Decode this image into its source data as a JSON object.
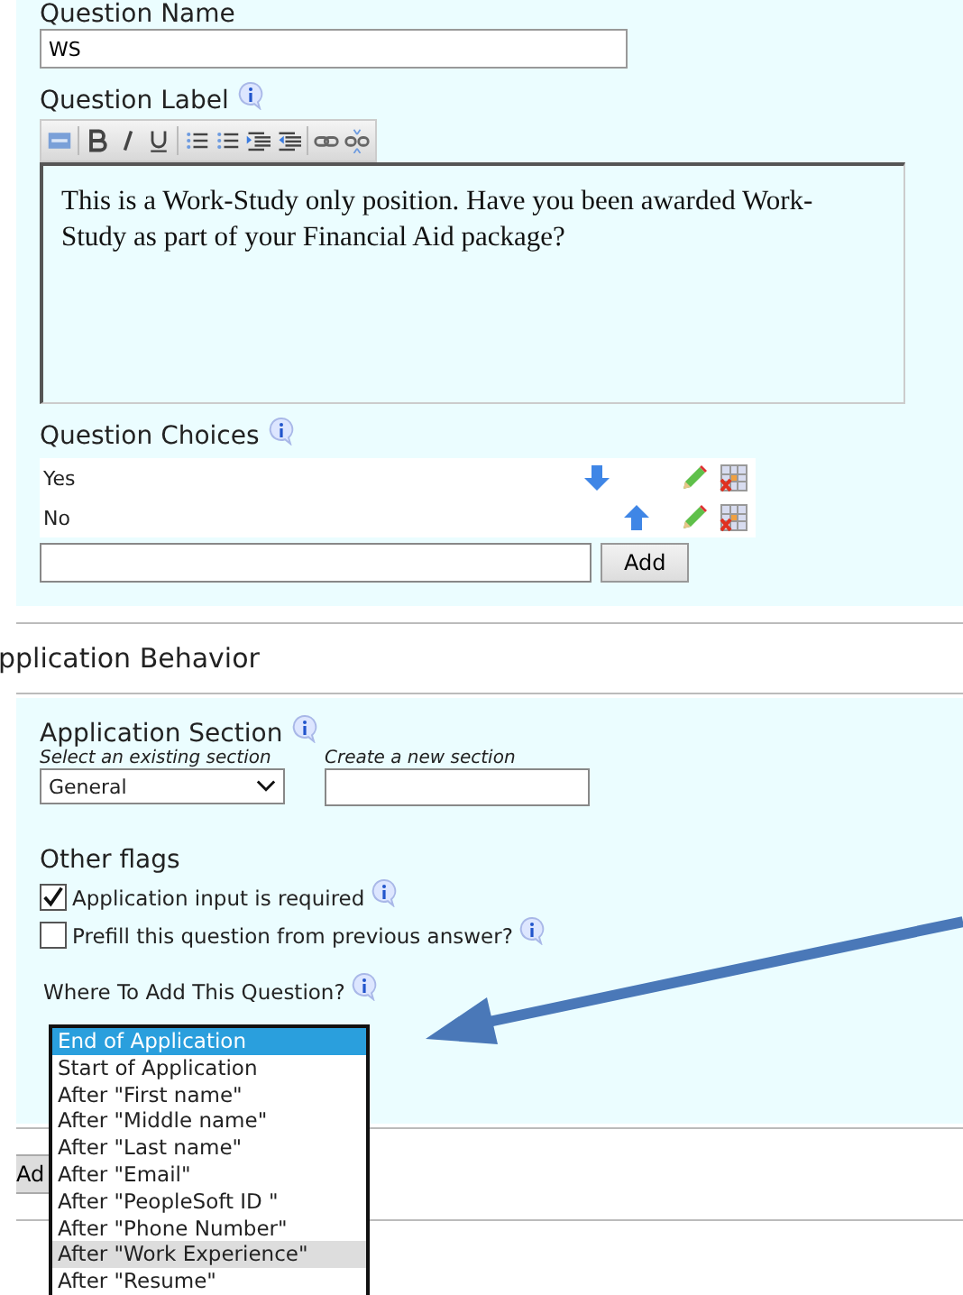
{
  "question_name": {
    "label": "Question Name",
    "value": "WS"
  },
  "question_label": {
    "label": "Question Label",
    "toolbar": [
      {
        "kind": "html"
      },
      {
        "kind": "bold"
      },
      {
        "kind": "italic"
      },
      {
        "kind": "underline"
      },
      {
        "kind": "numbered"
      },
      {
        "kind": "bulleted"
      },
      {
        "kind": "indent"
      },
      {
        "kind": "outdent"
      },
      {
        "kind": "link"
      },
      {
        "kind": "unlink"
      }
    ],
    "text": "This is a Work-Study only position. Have you been awarded Work-Study as part of your Financial Aid package?"
  },
  "question_choices": {
    "label": "Question Choices",
    "choices": [
      {
        "text": "Yes",
        "kind": "down"
      },
      {
        "text": "No",
        "kind": "up"
      }
    ],
    "add_button": "Add"
  },
  "section_header": "pplication Behavior",
  "application_section": {
    "label": "Application Section",
    "select_hint": "Select an existing section",
    "select_value": "General",
    "create_hint": "Create a new section"
  },
  "other_flags": {
    "label": "Other flags",
    "flags": [
      {
        "label": "Application input is required",
        "checked": true
      },
      {
        "label": "Prefill this question from previous answer?",
        "checked": false
      }
    ]
  },
  "where_to_add": {
    "label": "Where To Add This Question?",
    "options": [
      {
        "text": "End of Application",
        "selected": true,
        "hovered": false
      },
      {
        "text": "Start of Application",
        "selected": false,
        "hovered": false
      },
      {
        "text": "After \"First name\"",
        "selected": false,
        "hovered": false
      },
      {
        "text": "After \"Middle name\"",
        "selected": false,
        "hovered": false
      },
      {
        "text": "After \"Last name\"",
        "selected": false,
        "hovered": false
      },
      {
        "text": "After \"Email\"",
        "selected": false,
        "hovered": false
      },
      {
        "text": "After \"PeopleSoft ID \"",
        "selected": false,
        "hovered": false
      },
      {
        "text": "After \"Phone Number\"",
        "selected": false,
        "hovered": false
      },
      {
        "text": "After \"Work Experience\"",
        "selected": false,
        "hovered": true
      },
      {
        "text": "After \"Resume\"",
        "selected": false,
        "hovered": false
      }
    ]
  },
  "bottom_button": "Ad"
}
